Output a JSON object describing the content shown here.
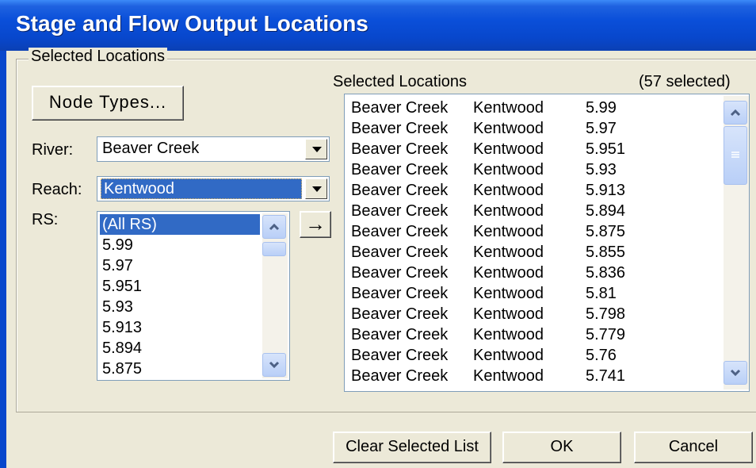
{
  "window": {
    "title": "Stage and Flow Output Locations"
  },
  "group": {
    "legend": "Selected Locations"
  },
  "buttons": {
    "node_types": "Node Types...",
    "clear": "Clear Selected List",
    "ok": "OK",
    "cancel": "Cancel",
    "add_arrow": "→"
  },
  "fields": {
    "river_label": "River:",
    "river_value": "Beaver Creek",
    "reach_label": "Reach:",
    "reach_value": "Kentwood",
    "rs_label": "RS:"
  },
  "rs_list": [
    "(All RS)",
    "5.99",
    "5.97",
    "5.951",
    "5.93",
    "5.913",
    "5.894",
    "5.875"
  ],
  "selected": {
    "header": "Selected Locations",
    "count": "(57 selected)",
    "rows": [
      [
        "Beaver Creek",
        "Kentwood",
        "5.99"
      ],
      [
        "Beaver Creek",
        "Kentwood",
        "5.97"
      ],
      [
        "Beaver Creek",
        "Kentwood",
        "5.951"
      ],
      [
        "Beaver Creek",
        "Kentwood",
        "5.93"
      ],
      [
        "Beaver Creek",
        "Kentwood",
        "5.913"
      ],
      [
        "Beaver Creek",
        "Kentwood",
        "5.894"
      ],
      [
        "Beaver Creek",
        "Kentwood",
        "5.875"
      ],
      [
        "Beaver Creek",
        "Kentwood",
        "5.855"
      ],
      [
        "Beaver Creek",
        "Kentwood",
        "5.836"
      ],
      [
        "Beaver Creek",
        "Kentwood",
        "5.81"
      ],
      [
        "Beaver Creek",
        "Kentwood",
        "5.798"
      ],
      [
        "Beaver Creek",
        "Kentwood",
        "5.779"
      ],
      [
        "Beaver Creek",
        "Kentwood",
        "5.76"
      ],
      [
        "Beaver Creek",
        "Kentwood",
        "5.741"
      ]
    ]
  }
}
